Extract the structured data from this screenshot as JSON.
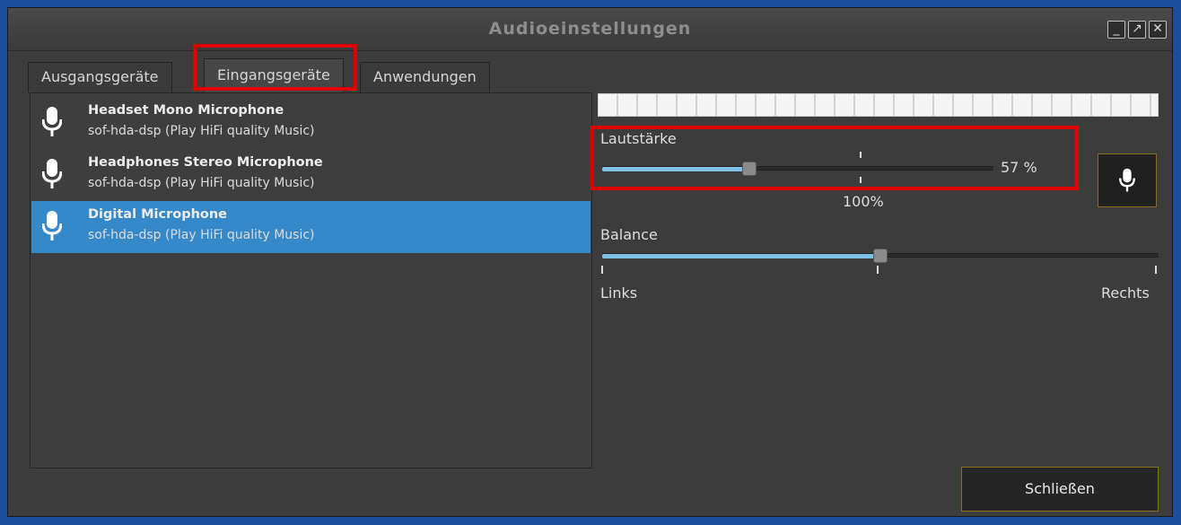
{
  "window": {
    "title": "Audioeinstellungen",
    "controls": {
      "minimize": "_",
      "maximize": "↗",
      "close": "✕"
    }
  },
  "tabs": [
    {
      "label": "Ausgangsgeräte",
      "active": false
    },
    {
      "label": "Eingangsgeräte",
      "active": true
    },
    {
      "label": "Anwendungen",
      "active": false
    }
  ],
  "devices": [
    {
      "name": "Headset Mono Microphone",
      "sub": "sof-hda-dsp (Play HiFi quality Music)",
      "icon": "microphone-icon",
      "selected": false
    },
    {
      "name": "Headphones Stereo Microphone",
      "sub": "sof-hda-dsp (Play HiFi quality Music)",
      "icon": "microphone-icon",
      "selected": false
    },
    {
      "name": "Digital Microphone",
      "sub": "sof-hda-dsp (Play HiFi quality Music)",
      "icon": "microphone-icon",
      "selected": true
    }
  ],
  "volume": {
    "label": "Lautstärke",
    "value_text": "57 %",
    "value_fraction": 0.57,
    "reference_label": "100%"
  },
  "balance": {
    "label": "Balance",
    "left_label": "Links",
    "right_label": "Rechts",
    "value_fraction": 0.5
  },
  "mute_button": {
    "icon": "microphone-icon"
  },
  "close_button": {
    "label": "Schließen"
  },
  "colors": {
    "accent_selection": "#3689c9",
    "slider_fill": "#7fc1e4",
    "highlight_annotation": "#e00000",
    "button_border": "#8a6d1c"
  }
}
